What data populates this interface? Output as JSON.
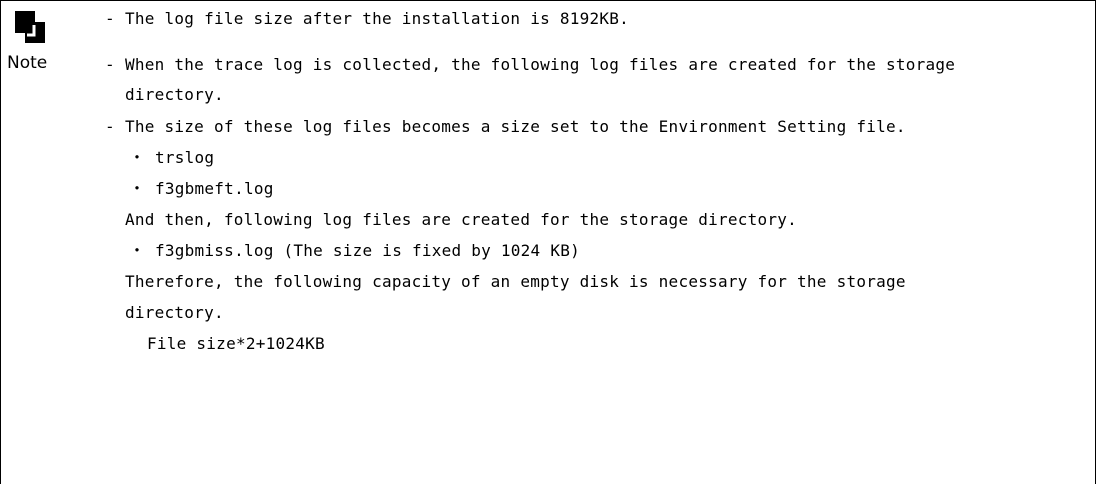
{
  "note": {
    "label": "Note",
    "icon": "note-icon"
  },
  "items": [
    {
      "dash": "-",
      "text": "The log file size after the installation is 8192KB."
    },
    {
      "dash": "-",
      "text_line1": "When the trace log is collected, the following log files are created for the storage",
      "text_line2": "directory."
    },
    {
      "dash": "-",
      "text": "The size of these log files becomes a size set to the Environment Setting file."
    }
  ],
  "sub": {
    "bullets1": [
      {
        "marker": "・",
        "text": "trslog"
      },
      {
        "marker": "・",
        "text": "f3gbmeft.log"
      }
    ],
    "then_text": "And then, following log files are created for the storage directory.",
    "bullets2": [
      {
        "marker": "・",
        "text": "f3gbmiss.log (The size is fixed by 1024 KB)"
      }
    ],
    "therefore_line1": "Therefore, the following capacity of an empty disk is necessary for the storage",
    "therefore_line2": "directory.",
    "formula": "File size*2+1024KB"
  }
}
